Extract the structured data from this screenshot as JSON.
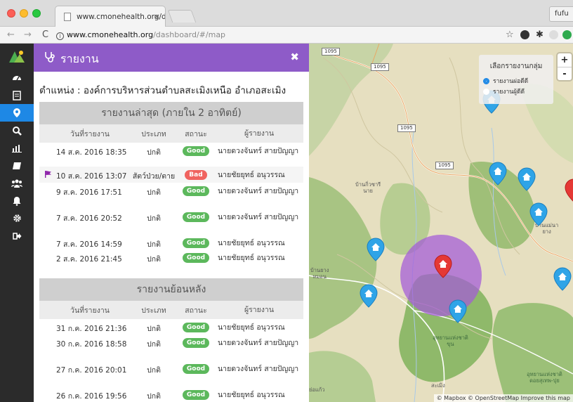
{
  "browser": {
    "tab_title": "www.cmonehealth.org/dashbo",
    "tab_close": "×",
    "profile": "fufu",
    "url_host": "www.cmonehealth.org",
    "url_path": "/dashboard/#/map",
    "back": "←",
    "forward": "→",
    "reload": "C",
    "bookmark": "☆"
  },
  "panel": {
    "title": "รายงาน",
    "close": "✖",
    "location": "ตำแหน่ง : องค์การบริหารส่วนตำบลสะเมิงเหนือ อำเภอสะเมิง"
  },
  "columns": {
    "date": "วันที่รายงาน",
    "type": "ประเภท",
    "status": "สถานะ",
    "reporter": "ผู้รายงาน"
  },
  "recent": {
    "title": "รายงานล่าสุด (ภายใน 2 อาทิตย์)",
    "rows": [
      {
        "date": "14 ส.ค. 2016 18:35",
        "type": "ปกติ",
        "status": "Good",
        "reporter": "นายดวงจันทร์ สายปัญญา"
      },
      {
        "date": "10 ส.ค. 2016 13:07",
        "type": "สัตว์ป่วย/ตาย",
        "status": "Bad",
        "reporter": "นายชัยยุทธ์ อนุวรรณ"
      },
      {
        "date": "9 ส.ค. 2016 17:51",
        "type": "ปกติ",
        "status": "Good",
        "reporter": "นายดวงจันทร์ สายปัญญา"
      },
      {
        "date": "7 ส.ค. 2016 20:52",
        "type": "ปกติ",
        "status": "Good",
        "reporter": "นายดวงจันทร์ สายปัญญา"
      },
      {
        "date": "7 ส.ค. 2016 14:59",
        "type": "ปกติ",
        "status": "Good",
        "reporter": "นายชัยยุทธ์ อนุวรรณ"
      },
      {
        "date": "2 ส.ค. 2016 21:45",
        "type": "ปกติ",
        "status": "Good",
        "reporter": "นายชัยยุทธ์ อนุวรรณ"
      }
    ]
  },
  "past": {
    "title": "รายงานย้อนหลัง",
    "rows": [
      {
        "date": "31 ก.ค. 2016 21:36",
        "type": "ปกติ",
        "status": "Good",
        "reporter": "นายชัยยุทธ์ อนุวรรณ"
      },
      {
        "date": "30 ก.ค. 2016 18:58",
        "type": "ปกติ",
        "status": "Good",
        "reporter": "นายดวงจันทร์ สายปัญญา"
      },
      {
        "date": "27 ก.ค. 2016 20:01",
        "type": "ปกติ",
        "status": "Good",
        "reporter": "นายดวงจันทร์ สายปัญญา"
      },
      {
        "date": "26 ก.ค. 2016 19:56",
        "type": "ปกติ",
        "status": "Good",
        "reporter": "นายชัยยุทธ์ อนุวรรณ"
      }
    ]
  },
  "map": {
    "legend_title": "เลือกรายงานกลุ่ม",
    "legend_option_1": "รายงานผ่อดีดี",
    "legend_option_2": "รายงานผู้ดีดี",
    "zoom_in": "+",
    "zoom_out": "-",
    "attribution": "© Mapbox © OpenStreetMap Improve this map",
    "road_1095": "1095",
    "labels": {
      "ban_kiu_sari": "บ้านกิ่วซารี\nนาย",
      "ban_mae_yang": "บ้านแม่นา\nยาง",
      "ban_mae_yuang": "บ้านยาง\nหมอน",
      "sameng": "สะเมิง",
      "mae_kaew": "ย่อแก้ว",
      "park_1": "อุทยานแห่งชาติ\nขุน",
      "park_2": "อุทยานแห่งชาติ\nดอยสุเทพ-ปุย"
    }
  },
  "colors": {
    "purple": "#8e5bc8",
    "sidebar": "#2b2b2b",
    "active": "#1e88e5",
    "good": "#5cb85c",
    "bad": "#f0635f",
    "marker_blue": "#2fa4e7",
    "marker_red": "#e53935",
    "radius": "#a45ad8"
  }
}
